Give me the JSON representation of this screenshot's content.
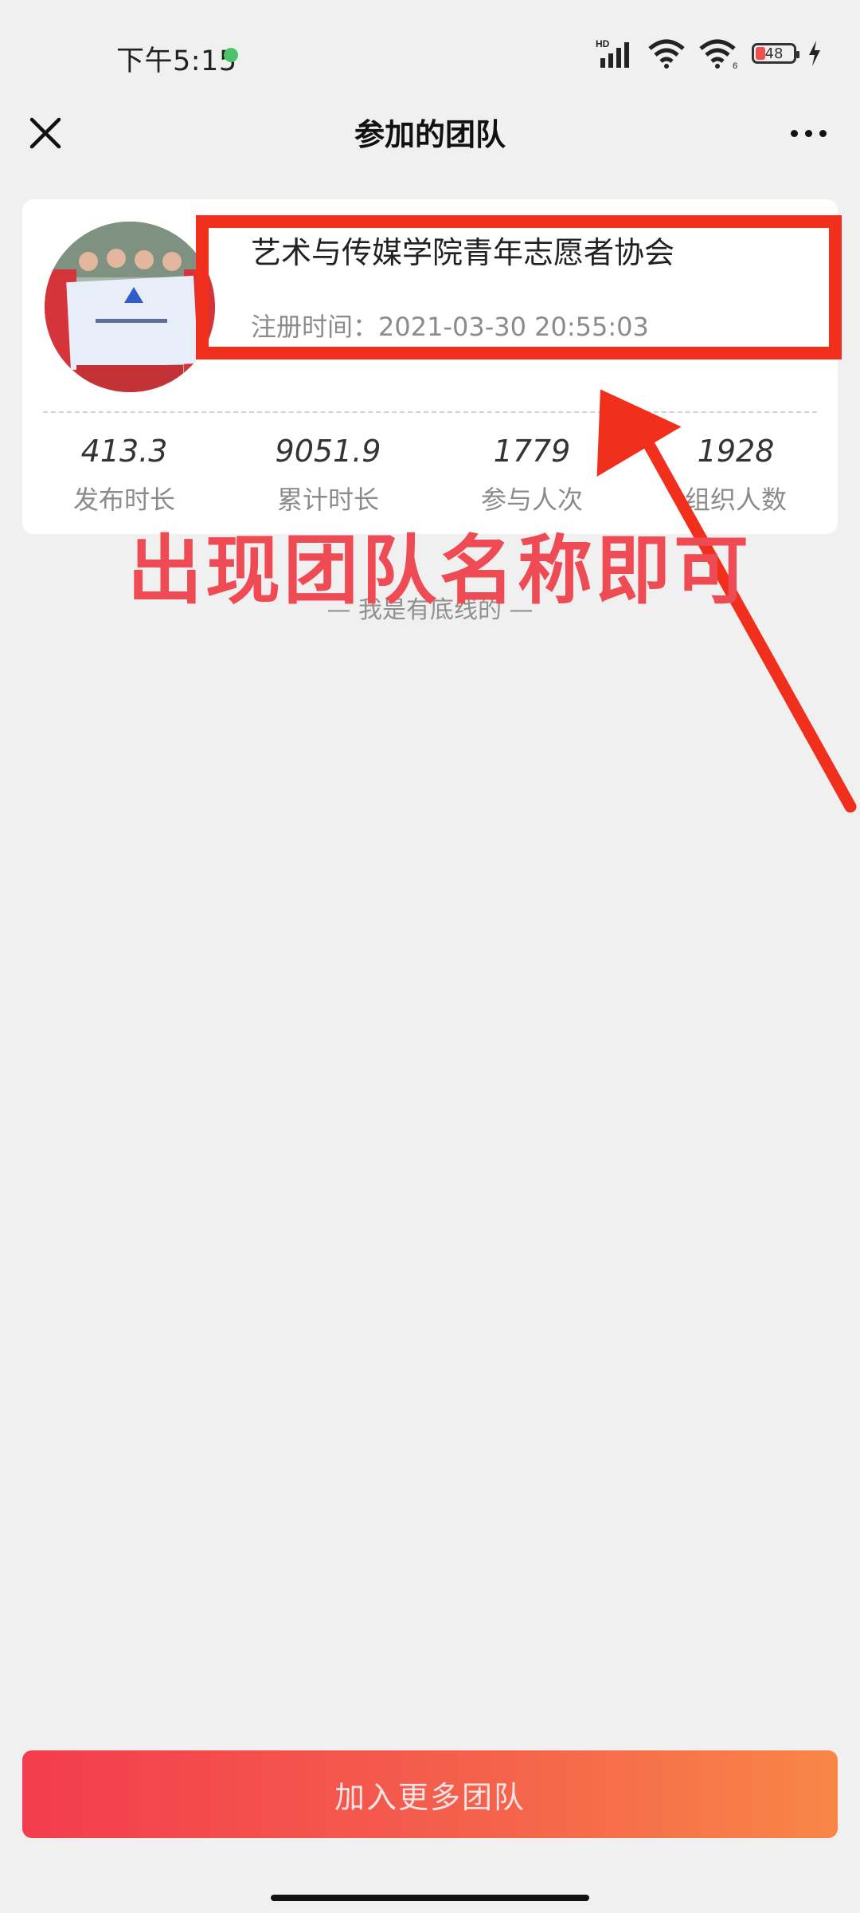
{
  "status_bar": {
    "time": "下午5:15",
    "hd_label": "HD",
    "wifi_badge": "6",
    "battery_level": "48"
  },
  "nav": {
    "title": "参加的团队",
    "close_icon": "close-icon",
    "more_icon": "more-icon"
  },
  "team": {
    "name": "艺术与传媒学院青年志愿者协会",
    "registered": "注册时间：2021-03-30 20:55:03",
    "avatar_icon": "team-photo",
    "stats": [
      {
        "value": "413.3",
        "label": "发布时长"
      },
      {
        "value": "9051.9",
        "label": "累计时长"
      },
      {
        "value": "1779",
        "label": "参与人次"
      },
      {
        "value": "1928",
        "label": "组织人数"
      }
    ]
  },
  "annotation": {
    "text": "出现团队名称即可",
    "color": "#f0301c"
  },
  "end_text": "—   我是有底线的   —",
  "join_button": "加入更多团队",
  "colors": {
    "button_start": "#f33c4e",
    "button_end": "#f98647"
  }
}
